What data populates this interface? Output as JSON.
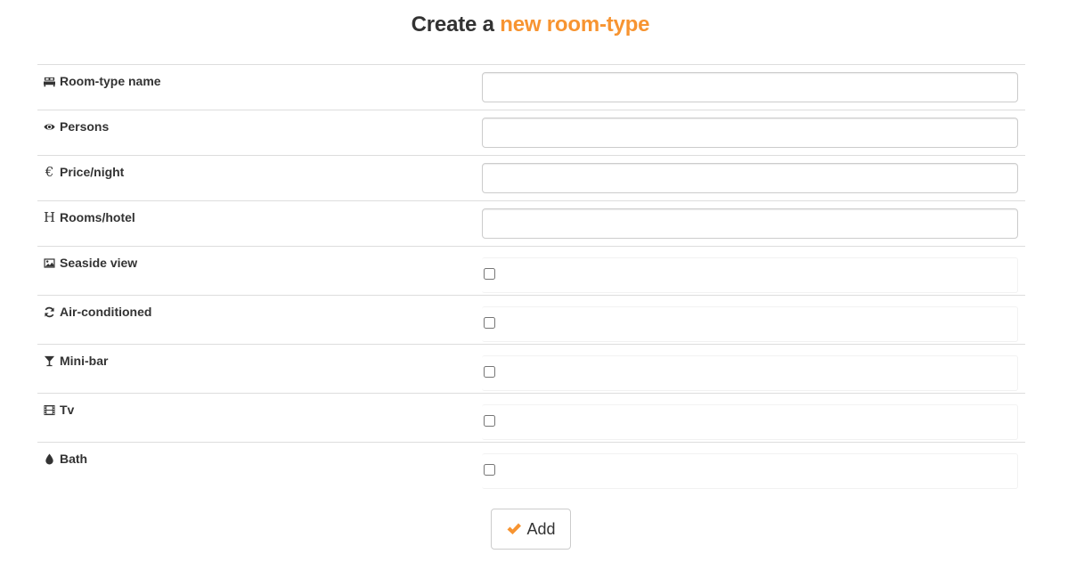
{
  "header": {
    "title_prefix": "Create a",
    "title_accent": "new room-type",
    "accent_color": "#f79431"
  },
  "fields": [
    {
      "label": "Room-type name",
      "icon": "bed-icon",
      "type": "text",
      "value": ""
    },
    {
      "label": "Persons",
      "icon": "eye-icon",
      "type": "text",
      "value": ""
    },
    {
      "label": "Price/night",
      "icon": "euro-icon",
      "type": "text",
      "value": ""
    },
    {
      "label": "Rooms/hotel",
      "icon": "h-icon",
      "type": "text",
      "value": ""
    },
    {
      "label": "Seaside view",
      "icon": "picture-icon",
      "type": "checkbox",
      "checked": false
    },
    {
      "label": "Air-conditioned",
      "icon": "refresh-icon",
      "type": "checkbox",
      "checked": false
    },
    {
      "label": "Mini-bar",
      "icon": "glass-icon",
      "type": "checkbox",
      "checked": false
    },
    {
      "label": "Tv",
      "icon": "film-icon",
      "type": "checkbox",
      "checked": false
    },
    {
      "label": "Bath",
      "icon": "drop-icon",
      "type": "checkbox",
      "checked": false
    }
  ],
  "actions": {
    "add_label": "Add",
    "add_icon": "checkmark-icon",
    "add_icon_color": "#f79431"
  }
}
